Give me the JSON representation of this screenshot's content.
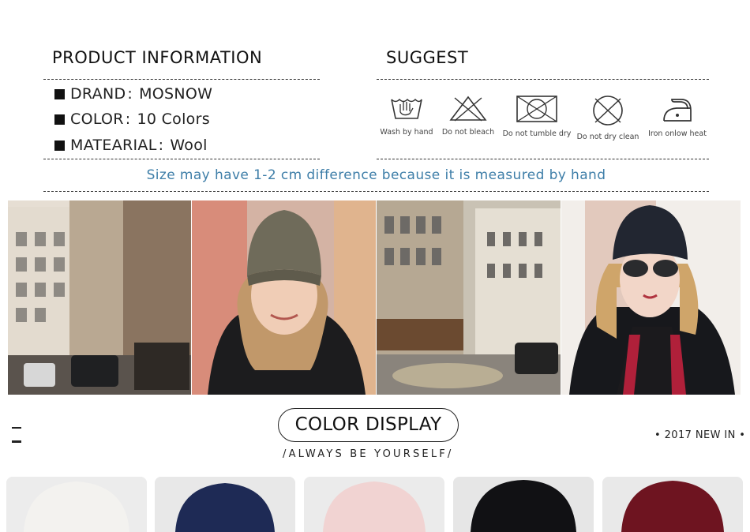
{
  "product_info": {
    "title": "PRODUCT INFORMATION",
    "rows": [
      {
        "label": "DRAND",
        "colon": ":",
        "value": "MOSNOW"
      },
      {
        "label": "COLOR",
        "colon": ":",
        "value": "10 Colors"
      },
      {
        "label": "MATEARIAL",
        "colon": ":",
        "value": "Wool"
      }
    ]
  },
  "suggest": {
    "title": "SUGGEST",
    "care": [
      {
        "icon": "wash-by-hand-icon",
        "label": "Wash by hand"
      },
      {
        "icon": "do-not-bleach-icon",
        "label": "Do not bleach"
      },
      {
        "icon": "do-not-tumble-dry-icon",
        "label": "Do not tumble dry"
      },
      {
        "icon": "do-not-dry-clean-icon",
        "label": "Do not dry clean"
      },
      {
        "icon": "iron-low-heat-icon",
        "label": "Iron onlow heat"
      }
    ]
  },
  "size_note": "Size may have 1-2 cm difference because it is measured by hand",
  "color_display": {
    "title": "COLOR DISPLAY",
    "tagline": "/ALWAYS BE YOURSELF/",
    "new_in": "2017 NEW IN",
    "swatches": [
      "#f3f2ef",
      "#1e2a55",
      "#f1d3d2",
      "#111114",
      "#6e1420"
    ]
  },
  "colors": {
    "note": "#3e7ea8",
    "text": "#111111"
  }
}
